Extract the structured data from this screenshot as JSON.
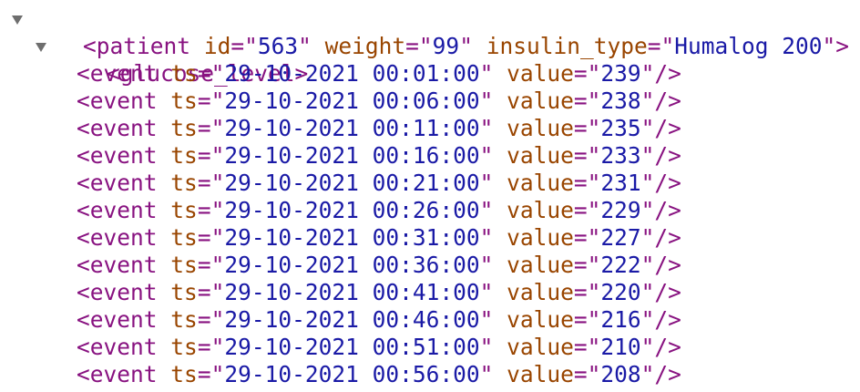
{
  "patient": {
    "tag": "patient",
    "attrs": [
      {
        "name": "id",
        "value": "563"
      },
      {
        "name": "weight",
        "value": "99"
      },
      {
        "name": "insulin_type",
        "value": "Humalog 200"
      }
    ]
  },
  "glucose_level": {
    "tag": "glucose_level"
  },
  "events": [
    {
      "tag": "event",
      "ts": "29-10-2021 00:01:00",
      "value": "239"
    },
    {
      "tag": "event",
      "ts": "29-10-2021 00:06:00",
      "value": "238"
    },
    {
      "tag": "event",
      "ts": "29-10-2021 00:11:00",
      "value": "235"
    },
    {
      "tag": "event",
      "ts": "29-10-2021 00:16:00",
      "value": "233"
    },
    {
      "tag": "event",
      "ts": "29-10-2021 00:21:00",
      "value": "231"
    },
    {
      "tag": "event",
      "ts": "29-10-2021 00:26:00",
      "value": "229"
    },
    {
      "tag": "event",
      "ts": "29-10-2021 00:31:00",
      "value": "227"
    },
    {
      "tag": "event",
      "ts": "29-10-2021 00:36:00",
      "value": "222"
    },
    {
      "tag": "event",
      "ts": "29-10-2021 00:41:00",
      "value": "220"
    },
    {
      "tag": "event",
      "ts": "29-10-2021 00:46:00",
      "value": "216"
    },
    {
      "tag": "event",
      "ts": "29-10-2021 00:51:00",
      "value": "210"
    },
    {
      "tag": "event",
      "ts": "29-10-2021 00:56:00",
      "value": "208"
    }
  ],
  "labels": {
    "ts_attr": "ts",
    "value_attr": "value"
  },
  "colors": {
    "tag": "#881280",
    "attr_name": "#994500",
    "attr_value": "#1a1aa6",
    "toggle": "#6e6e6e"
  }
}
